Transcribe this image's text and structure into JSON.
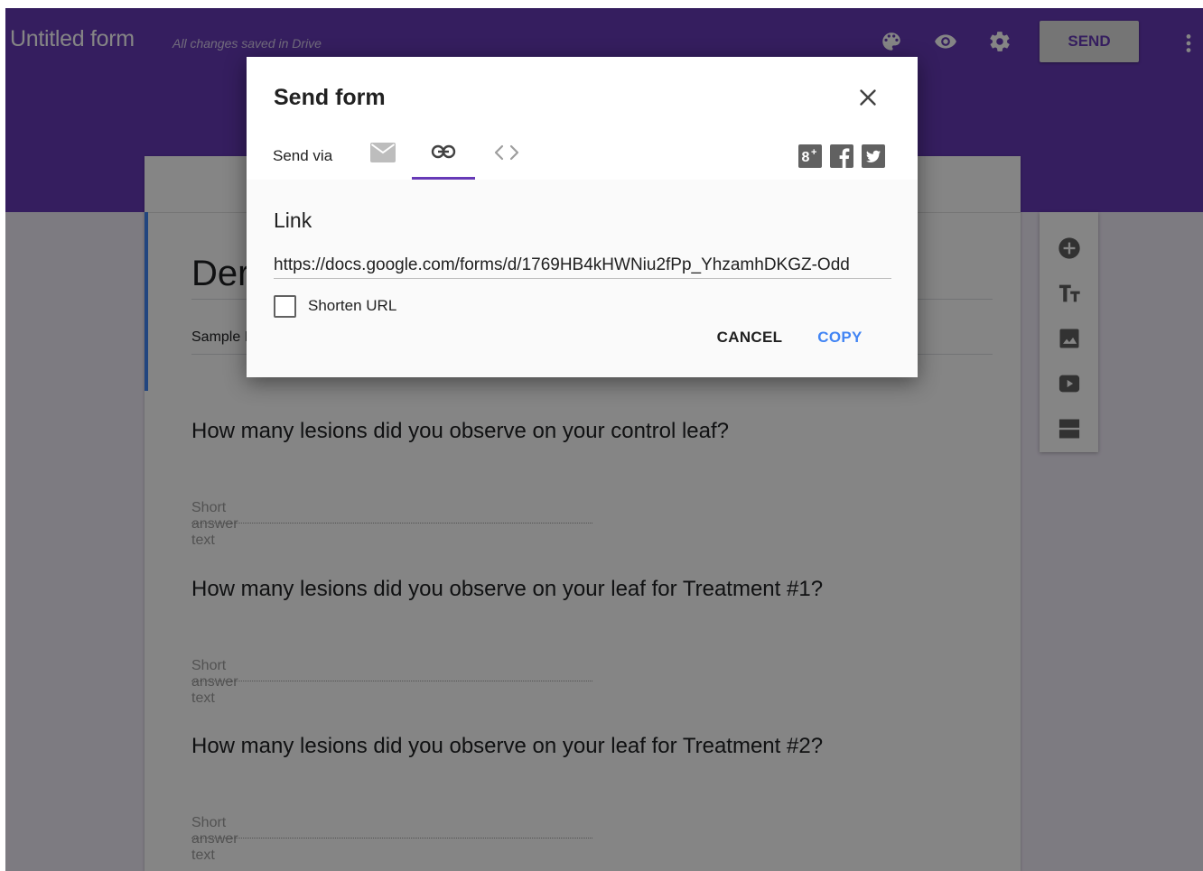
{
  "header": {
    "title": "Untitled form",
    "save_status": "All changes saved in Drive",
    "send_label": "SEND",
    "accent_color": "#673ab7"
  },
  "form": {
    "heading_visible": "Der",
    "description_visible": "Sample I",
    "questions": [
      {
        "title": "How many lesions did you observe on your control leaf?",
        "answer_placeholder": "Short answer text"
      },
      {
        "title": "How many lesions did you observe on your leaf for Treatment #1?",
        "answer_placeholder": "Short answer text"
      },
      {
        "title": "How many lesions did you observe on your leaf for Treatment #2?",
        "answer_placeholder": "Short answer text"
      }
    ]
  },
  "toolbar": {
    "tools": [
      "add-question-icon",
      "title-text-icon",
      "image-icon",
      "video-icon",
      "section-icon"
    ]
  },
  "dialog": {
    "title": "Send form",
    "send_via_label": "Send via",
    "tabs": [
      "email-icon",
      "link-icon",
      "embed-icon"
    ],
    "active_tab": "link",
    "social": [
      "google-plus-icon",
      "facebook-icon",
      "twitter-icon"
    ],
    "link_label": "Link",
    "link_url": "https://docs.google.com/forms/d/1769HB4kHWNiu2fPp_YhzamhDKGZ-Odd",
    "shorten_label": "Shorten URL",
    "shorten_checked": false,
    "cancel_label": "CANCEL",
    "copy_label": "COPY",
    "copy_color": "#4285f4"
  }
}
